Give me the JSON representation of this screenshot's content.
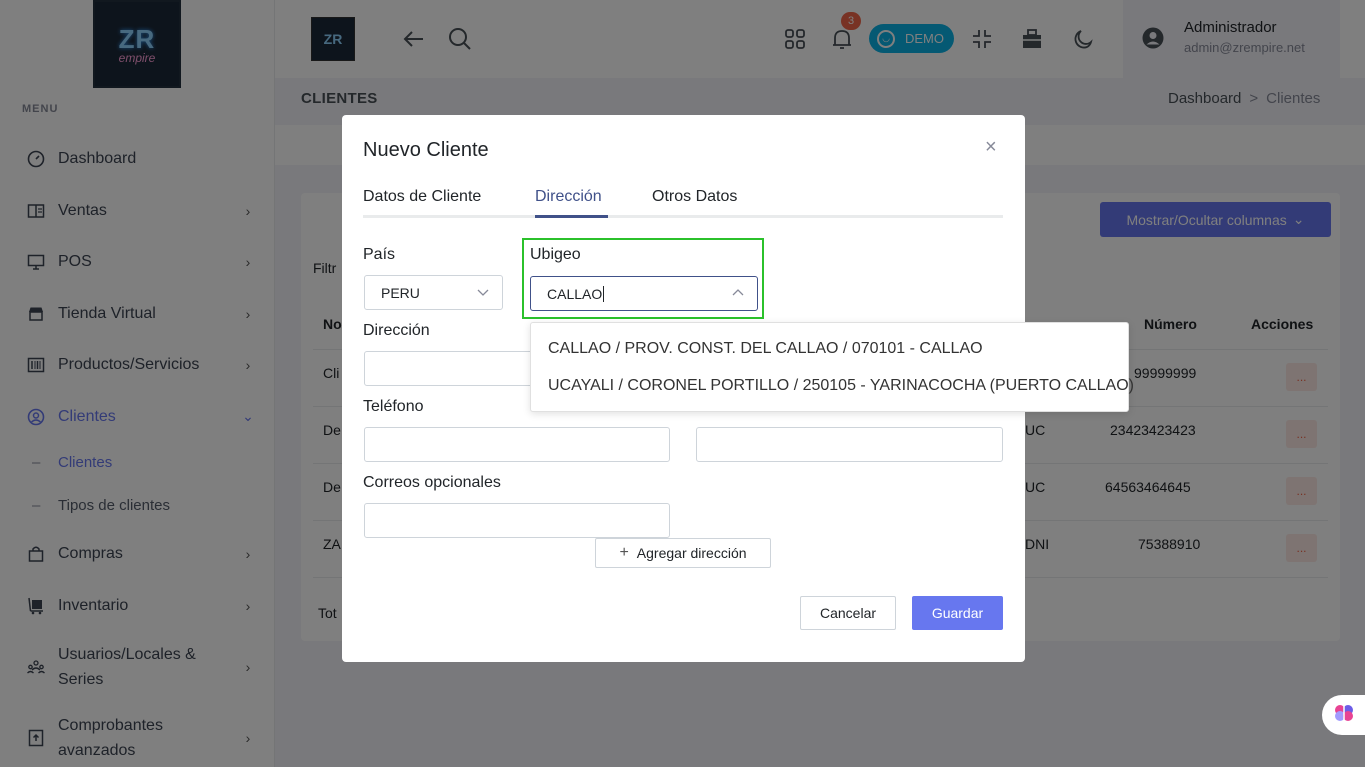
{
  "sidebar": {
    "logo_line1": "ZR",
    "logo_line2": "empire",
    "menu_title": "MENU",
    "items": [
      {
        "label": "Dashboard"
      },
      {
        "label": "Ventas"
      },
      {
        "label": "POS"
      },
      {
        "label": "Tienda Virtual"
      },
      {
        "label": "Productos/Servicios"
      },
      {
        "label": "Clientes"
      },
      {
        "label": "Compras"
      },
      {
        "label": "Inventario"
      },
      {
        "label": "Usuarios/Locales &",
        "label2": "Series"
      },
      {
        "label": "Comprobantes",
        "label2": "avanzados"
      }
    ],
    "subitems": [
      {
        "label": "Clientes"
      },
      {
        "label": "Tipos de clientes"
      }
    ]
  },
  "topbar": {
    "notification_count": "3",
    "demo_label": "DEMO",
    "user_name": "Administrador",
    "user_email": "admin@zrempire.net"
  },
  "page": {
    "title": "CLIENTES",
    "breadcrumb": [
      "Dashboard",
      ">",
      "Clientes"
    ],
    "columns_button": "Mostrar/Ocultar columnas",
    "filter_fragment": "Filtr",
    "total_fragment": "Tot",
    "table_headers": {
      "col1": "No",
      "col_tipo": "...",
      "numero": "Número",
      "acciones": "Acciones"
    },
    "rows": [
      {
        "name": "Cli",
        "tipo": "",
        "numero": "99999999",
        "action": "..."
      },
      {
        "name": "De",
        "tipo": "UC",
        "numero": "23423423423",
        "action": "..."
      },
      {
        "name": "De",
        "tipo": "UC",
        "numero": "64563464645",
        "action": "..."
      },
      {
        "name": "ZA",
        "tipo": "DNI",
        "numero": "75388910",
        "action": "..."
      }
    ]
  },
  "modal": {
    "title": "Nuevo Cliente",
    "tabs": [
      "Datos de Cliente",
      "Dirección",
      "Otros Datos"
    ],
    "active_tab": "Dirección",
    "labels": {
      "pais": "País",
      "ubigeo": "Ubigeo",
      "direccion": "Dirección",
      "telefono": "Teléfono",
      "correos": "Correos opcionales"
    },
    "pais_value": "PERU",
    "ubigeo_value": "CALLAO",
    "add_address_button": "Agregar dirección",
    "cancel_button": "Cancelar",
    "save_button": "Guardar"
  },
  "ubigeo_dropdown": {
    "options": [
      "CALLAO / PROV. CONST. DEL CALLAO / 070101 - CALLAO",
      "UCAYALI / CORONEL PORTILLO / 250105 - YARINACOCHA (PUERTO CALLAO)"
    ]
  },
  "colors": {
    "accent": "#6777ef",
    "demo": "#0ab3e6",
    "highlight_box": "#2bc12b",
    "badge": "#f06548"
  }
}
